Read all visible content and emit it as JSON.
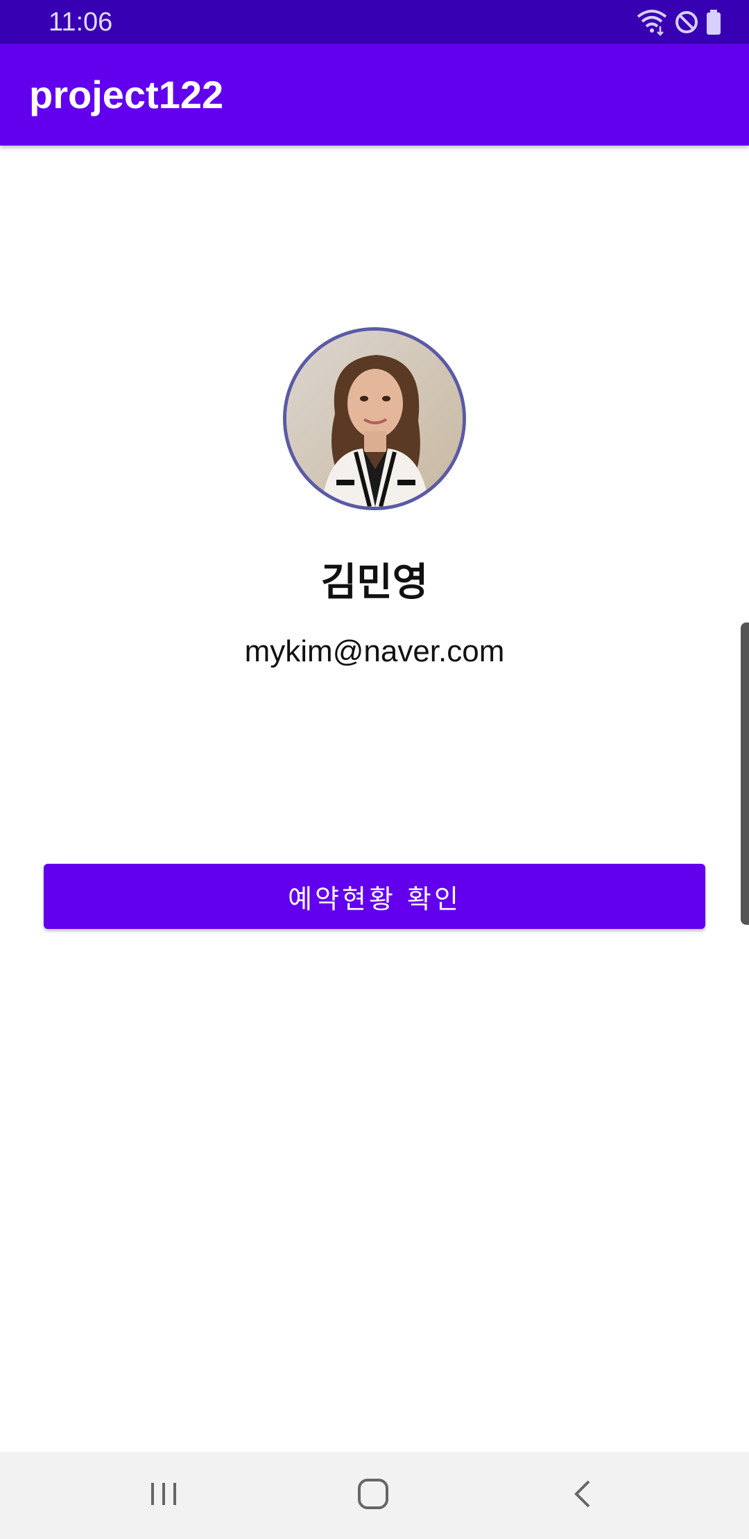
{
  "status_bar": {
    "time": "11:06",
    "icons": [
      "wifi-icon",
      "do-not-disturb-icon",
      "battery-icon"
    ]
  },
  "app_bar": {
    "title": "project122"
  },
  "profile": {
    "avatar": "profile-photo",
    "name": "김민영",
    "email": "mykim@naver.com"
  },
  "actions": {
    "reservation_button_label": "예약현황 확인"
  },
  "nav_bar": {
    "buttons": [
      "recents-icon",
      "home-icon",
      "back-icon"
    ]
  },
  "colors": {
    "status_bar": "#3700b3",
    "primary": "#6200ee",
    "avatar_border": "#5a5aa5",
    "nav_bar": "#f2f2f2"
  }
}
